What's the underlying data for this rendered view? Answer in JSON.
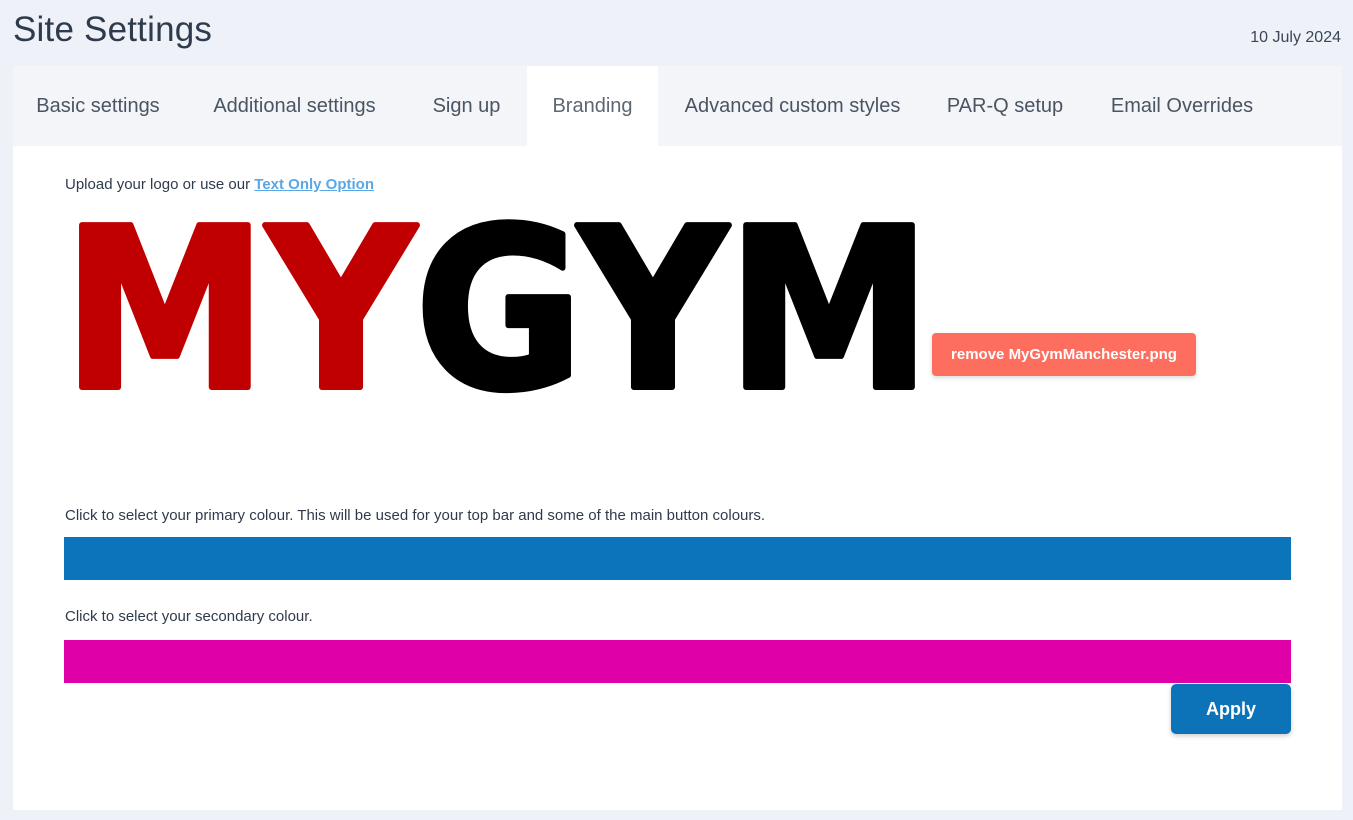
{
  "header": {
    "title": "Site Settings",
    "date": "10 July 2024"
  },
  "tabs": [
    {
      "label": "Basic settings",
      "active": false
    },
    {
      "label": "Additional settings",
      "active": false
    },
    {
      "label": "Sign up",
      "active": false
    },
    {
      "label": "Branding",
      "active": true
    },
    {
      "label": "Advanced custom styles",
      "active": false
    },
    {
      "label": "PAR-Q setup",
      "active": false
    },
    {
      "label": "Email Overrides",
      "active": false
    }
  ],
  "branding": {
    "upload_prompt": "Upload your logo or use our ",
    "text_only_link": "Text Only Option",
    "logo": {
      "text_part1": "MY",
      "text_part2": "GYM",
      "color_part1": "#c00000",
      "color_part2": "#000000"
    },
    "remove_button": "remove MyGymManchester.png",
    "primary_label": "Click to select your primary colour. This will be used for your top bar and some of the main button colours.",
    "primary_color": "#0b74bb",
    "secondary_label": "Click to select your secondary colour.",
    "secondary_color": "#e000a8",
    "apply_button": "Apply"
  },
  "colors": {
    "page_background": "#eef2f8",
    "tab_bar": "#f3f5f9",
    "remove_button": "#fd6e5e",
    "apply_button": "#0d73b8",
    "link": "#5aa7e6"
  }
}
